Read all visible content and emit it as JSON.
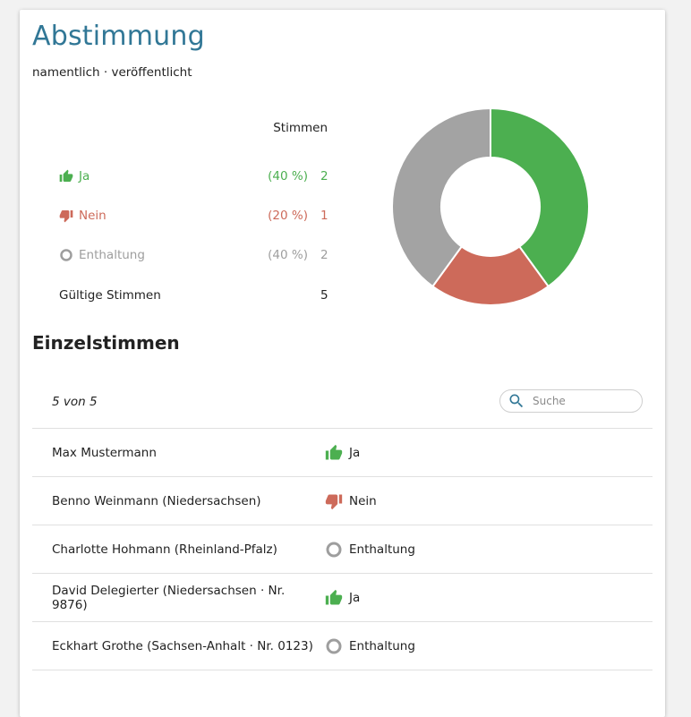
{
  "page": {
    "title": "Abstimmung",
    "subtitle": "namentlich · veröffentlicht"
  },
  "results": {
    "header": "Stimmen",
    "rows": [
      {
        "label": "Ja",
        "percent": "(40 %)",
        "count": "2",
        "icon": "thumbs-up-icon",
        "color": "#4caf50"
      },
      {
        "label": "Nein",
        "percent": "(20 %)",
        "count": "1",
        "icon": "thumbs-down-icon",
        "color": "#cd6a5a"
      },
      {
        "label": "Enthaltung",
        "percent": "(40 %)",
        "count": "2",
        "icon": "circle-icon",
        "color": "#9e9e9e"
      }
    ],
    "valid_label": "Gültige Stimmen",
    "valid_count": "5"
  },
  "chart_data": {
    "type": "pie",
    "donut": true,
    "categories": [
      "Ja",
      "Nein",
      "Enthaltung"
    ],
    "values": [
      2,
      1,
      2
    ],
    "colors": [
      "#4caf50",
      "#cd6a5a",
      "#a3a3a3"
    ]
  },
  "votes_section": {
    "title": "Einzelstimmen",
    "count_text": "5 von 5",
    "search_placeholder": "Suche",
    "rows": [
      {
        "name": "Max Mustermann",
        "vote": "Ja",
        "icon": "thumbs-up-icon"
      },
      {
        "name": "Benno Weinmann (Niedersachsen)",
        "vote": "Nein",
        "icon": "thumbs-down-icon"
      },
      {
        "name": "Charlotte Hohmann (Rheinland-Pfalz)",
        "vote": "Enthaltung",
        "icon": "circle-icon"
      },
      {
        "name": "David Delegierter (Niedersachsen · Nr. 9876)",
        "vote": "Ja",
        "icon": "thumbs-up-icon"
      },
      {
        "name": "Eckhart Grothe (Sachsen-Anhalt · Nr. 0123)",
        "vote": "Enthaltung",
        "icon": "circle-icon"
      }
    ]
  }
}
